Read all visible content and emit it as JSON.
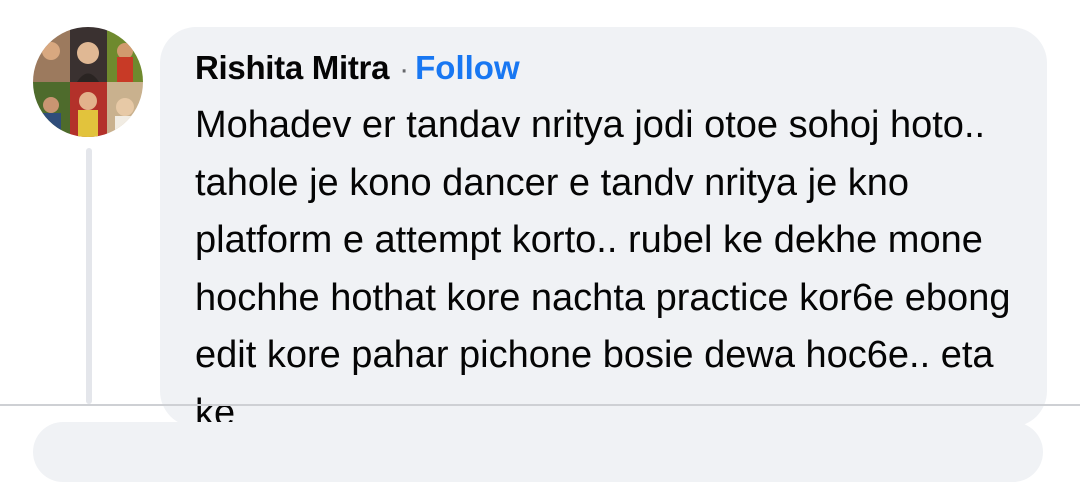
{
  "comment": {
    "author": "Rishita Mitra",
    "separator": "·",
    "follow_label": "Follow",
    "text": "Mohadev er tandav nritya jodi otoe sohoj hoto.. tahole je kono dancer e tandv nritya je kno platform e attempt korto.. rubel ke dekhe mone hochhe hothat kore nachta practice kor6e ebong edit kore pahar pichone bosie dewa hoc6e.. eta ke"
  },
  "colors": {
    "follow": "#1877f2",
    "bubble": "#f0f2f5",
    "text": "#050505"
  },
  "icons": {
    "avatar": "profile-photo-collage"
  }
}
